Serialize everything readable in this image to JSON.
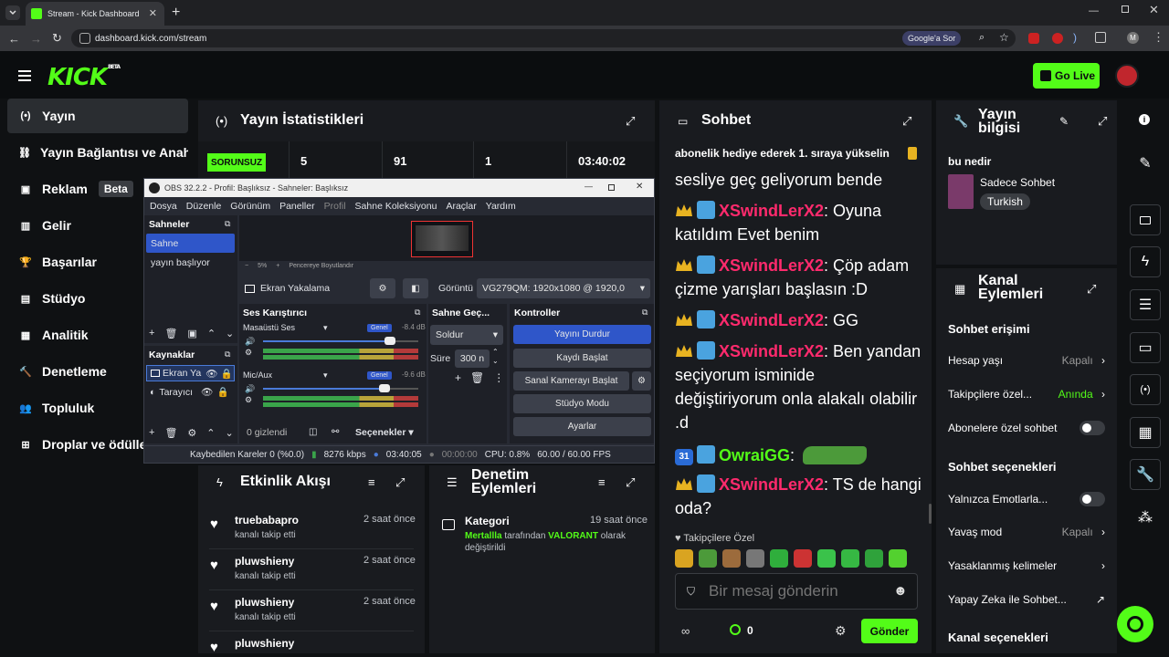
{
  "browser": {
    "tab_title": "Stream - Kick Dashboard",
    "url": "dashboard.kick.com/stream",
    "ask_google": "Google'a Sor"
  },
  "header": {
    "logo": "KICK",
    "logo_badge": "BETA",
    "go_live": "Go Live"
  },
  "sidebar": {
    "items": [
      {
        "label": "Yayın",
        "icon": "broadcast-icon",
        "active": true
      },
      {
        "label": "Yayın Bağlantısı ve Anahtarı",
        "icon": "link-icon"
      },
      {
        "label": "Reklam",
        "icon": "ad-icon",
        "badge": "Beta"
      },
      {
        "label": "Gelir",
        "icon": "money-icon"
      },
      {
        "label": "Başarılar",
        "icon": "trophy-icon"
      },
      {
        "label": "Stüdyo",
        "icon": "studio-icon"
      },
      {
        "label": "Analitik",
        "icon": "chart-icon"
      },
      {
        "label": "Denetleme",
        "icon": "gavel-icon"
      },
      {
        "label": "Topluluk",
        "icon": "people-icon"
      },
      {
        "label": "Droplar ve ödüller",
        "icon": "gift-icon"
      }
    ]
  },
  "stats": {
    "title": "Yayın İstatistikleri",
    "status": "SORUNSUZ",
    "values": [
      "5",
      "91",
      "1",
      "03:40:02"
    ]
  },
  "obs": {
    "title": "OBS 32.2.2 - Profil: Başlıksız - Sahneler: Başlıksız",
    "menu": [
      "Dosya",
      "Düzenle",
      "Görünüm",
      "Paneller",
      "Profil",
      "Sahne Koleksiyonu",
      "Araçlar",
      "Yardım"
    ],
    "scenes_title": "Sahneler",
    "scenes": [
      "Sahne",
      "yayın başlıyor"
    ],
    "zoom": "5%",
    "resize": "Pencereye Boyutlandır",
    "source_label": "Ekran Yakalama",
    "display_label": "Görüntü",
    "display_value": "VG279QM: 1920x1080 @ 1920,0",
    "sources_title": "Kaynaklar",
    "sources": [
      "Ekran Ya",
      "Tarayıcı"
    ],
    "mixer_title": "Ses Karıştırıcı",
    "mixer": [
      {
        "name": "Masaüstü Ses",
        "tag": "Genel",
        "db": "-8.4 dB",
        "level": 0.82
      },
      {
        "name": "Mic/Aux",
        "tag": "Genel",
        "db": "-9.6 dB",
        "level": 0.78
      }
    ],
    "mixer_hidden": "0 gizlendi",
    "options": "Seçenekler",
    "transition_title": "Sahne Geç...",
    "transition_value": "Soldur",
    "duration_label": "Süre",
    "duration_value": "300 n",
    "controls_title": "Kontroller",
    "controls": [
      "Yayını Durdur",
      "Kaydı Başlat",
      "Sanal Kamerayı Başlat",
      "Stüdyo Modu",
      "Ayarlar"
    ],
    "status": {
      "dropped": "Kaybedilen Kareler 0 (%0.0)",
      "bitrate": "8276 kbps",
      "stream_time": "03:40:05",
      "rec_time": "00:00:00",
      "cpu": "CPU: 0.8%",
      "fps": "60.00 / 60.00 FPS"
    }
  },
  "chat": {
    "title": "Sohbet",
    "pinned": "abonelik hediye ederek 1. sıraya yükselin",
    "messages": [
      {
        "user": "",
        "text": "sesliye geç geliyorum bende"
      },
      {
        "user": "XSwindLerX2",
        "text": ": Oyuna katıldım Evet benim"
      },
      {
        "user": "XSwindLerX2",
        "text": ": Çöp adam çizme yarışları başlasın :D"
      },
      {
        "user": "XSwindLerX2",
        "text": ": GG"
      },
      {
        "user": "XSwindLerX2",
        "text": ": Ben yandan seçiyorum isminide değiştiriyorum onla alakalı olabilir .d"
      },
      {
        "user": "OwraiGG",
        "text": ":",
        "badge": "31"
      },
      {
        "user": "XSwindLerX2",
        "text": ": TS de hangi oda?"
      }
    ],
    "followers_only": "Takipçilere Özel",
    "placeholder": "Bir mesaj gönderin",
    "viewers": "0",
    "send": "Gönder"
  },
  "info": {
    "title": "Yayın bilgisi",
    "stream_title": "bu nedir",
    "category": "Sadece Sohbet",
    "tag": "Turkish"
  },
  "channel": {
    "title": "Kanal Eylemleri",
    "chat_access": "Sohbet erişimi",
    "rows": [
      {
        "label": "Hesap yaşı",
        "value": "Kapalı"
      },
      {
        "label": "Takipçilere özel...",
        "value": "Anında"
      },
      {
        "label": "Abonelere özel sohbet",
        "value": ""
      }
    ],
    "chat_options": "Sohbet seçenekleri",
    "rows2": [
      {
        "label": "Yalnızca Emotlarla...",
        "value": ""
      },
      {
        "label": "Yavaş mod",
        "value": "Kapalı"
      },
      {
        "label": "Yasaklanmış kelimeler",
        "value": ""
      },
      {
        "label": "Yapay Zeka ile Sohbet...",
        "value": ""
      }
    ],
    "channel_options": "Kanal seçenekleri"
  },
  "activity": {
    "title": "Etkinlik Akışı",
    "items": [
      {
        "name": "truebabapro",
        "action": "kanalı takip etti",
        "time": "2 saat önce"
      },
      {
        "name": "pluwshieny",
        "action": "kanalı takip etti",
        "time": "2 saat önce"
      },
      {
        "name": "pluwshieny",
        "action": "kanalı takip etti",
        "time": "2 saat önce"
      },
      {
        "name": "pluwshieny",
        "action": "",
        "time": ""
      }
    ]
  },
  "moderation": {
    "title": "Denetim Eylemleri",
    "item": {
      "name": "Kategori",
      "time": "19 saat önce",
      "actor": "Mertallla",
      "mid": " tarafından ",
      "game": "VALORANT",
      "tail": " olarak değiştirildi"
    }
  },
  "colors": {
    "accent": "#53fc18",
    "username": "#ff2a6d",
    "username2": "#53fc18",
    "obs_button": "#2f56c9"
  }
}
